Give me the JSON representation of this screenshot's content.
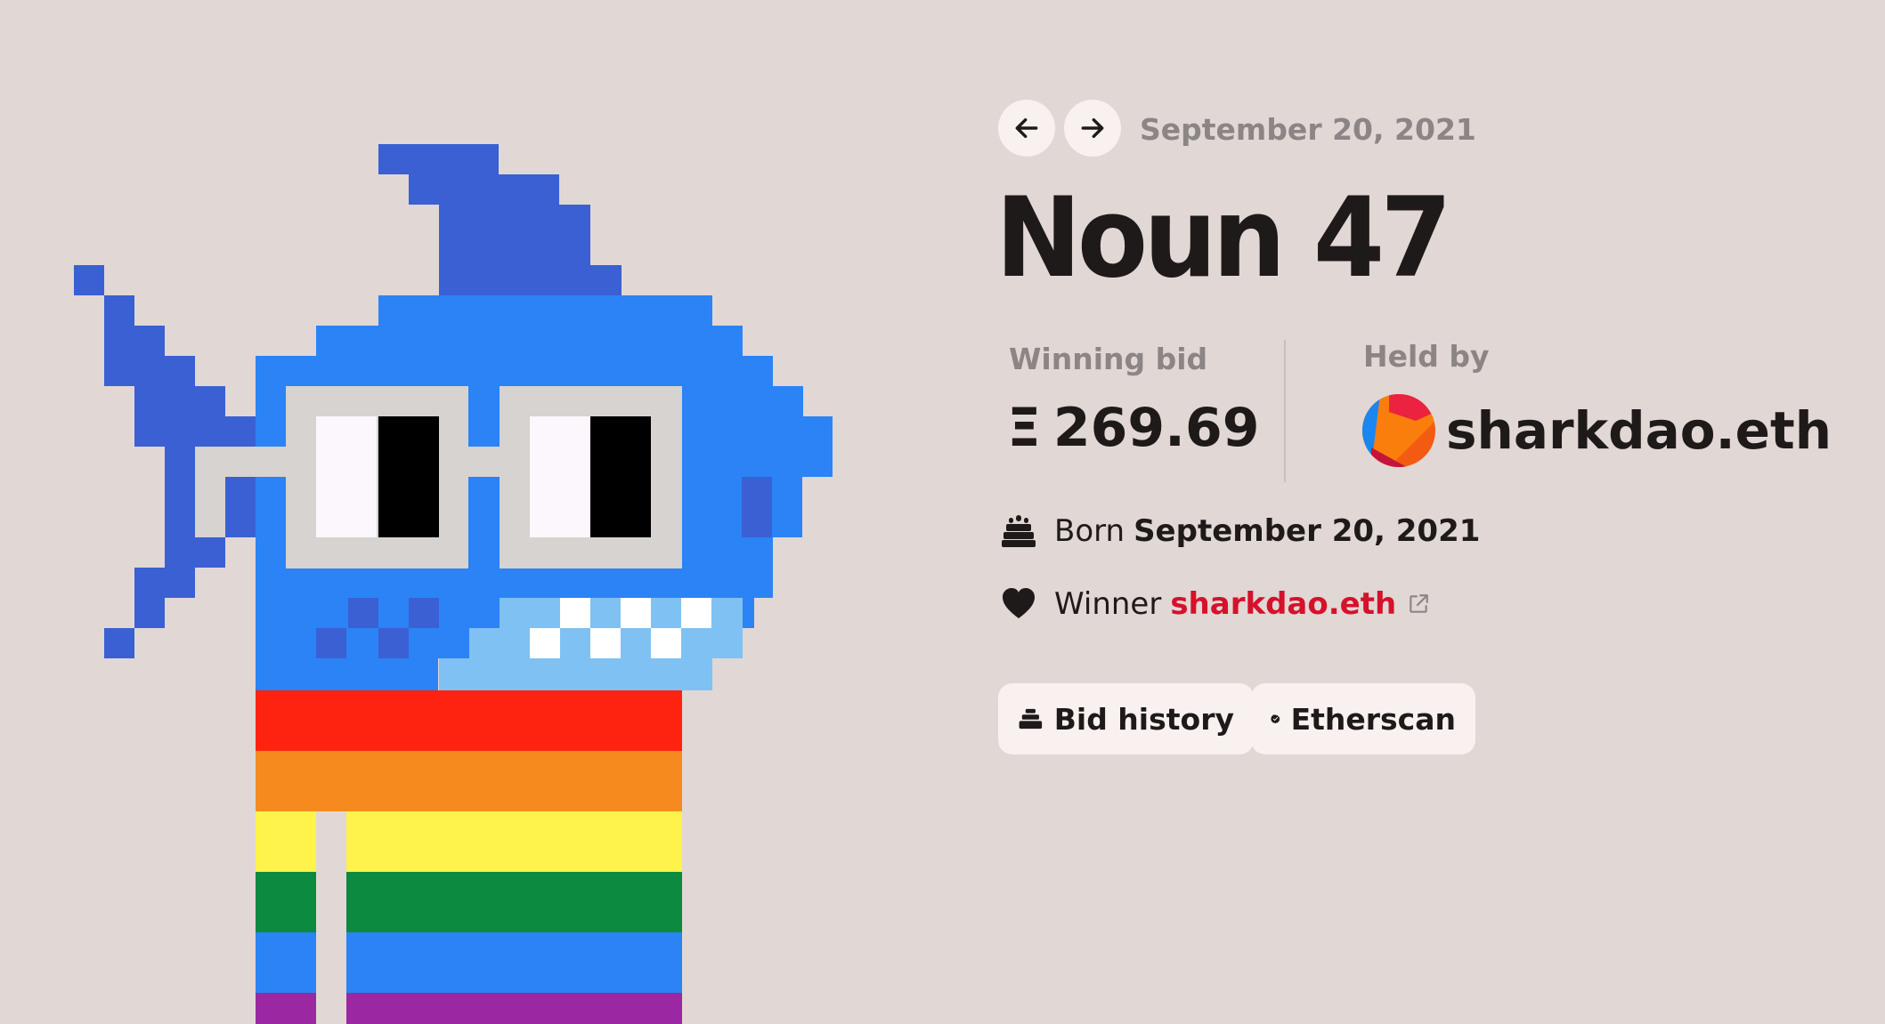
{
  "auction": {
    "date": "September 20, 2021",
    "title": "Noun 47",
    "winning_bid_label": "Winning bid",
    "eth_symbol": "Ξ",
    "winning_bid_value": "269.69",
    "held_by_label": "Held by",
    "holder_name": "sharkdao.eth"
  },
  "details": {
    "born_label": "Born",
    "born_date": "September 20, 2021",
    "winner_label": "Winner",
    "winner_name": "sharkdao.eth"
  },
  "actions": {
    "bid_history_label": "Bid history",
    "etherscan_label": "Etherscan"
  },
  "icons": {
    "prev": "arrow-left-icon",
    "next": "arrow-right-icon",
    "born": "cake-icon",
    "winner": "heart-icon",
    "external": "external-link-icon",
    "bid_history": "stack-icon",
    "etherscan": "verified-check-icon"
  },
  "colors": {
    "background": "#e1d7d5",
    "button_bg": "#f8f1f0",
    "muted_text": "#8c8585",
    "primary_text": "#1f1a1a",
    "winner_link": "#d5112b",
    "shark_body": "#2b83f6",
    "shark_fin": "#3a60d3",
    "glasses_frame": "#d6d3d0"
  }
}
